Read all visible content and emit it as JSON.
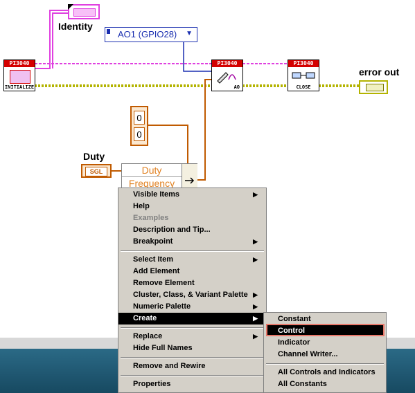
{
  "diagram": {
    "identity_label": "Identity",
    "error_out_label": "error out",
    "duty_label": "Duty",
    "ring_value": "AO1 (GPIO28)",
    "sgl_label": "SGL",
    "bundle_items": [
      "Duty",
      "Frequency"
    ],
    "numeric_values": [
      "0",
      "0"
    ],
    "vis": {
      "initialize": {
        "header": "PI3040",
        "caption": "INITIALIZE"
      },
      "write_ao": {
        "header": "PI3040",
        "caption": "AO"
      },
      "close": {
        "header": "PI3040",
        "caption": "CLOSE"
      }
    },
    "colors": {
      "error_wire": "#b3b300",
      "refnum_wire": "#e040e0",
      "ring_wire": "#1a2fb0",
      "cluster_wire": "#c05a00"
    }
  },
  "context_menu": {
    "items": [
      {
        "label": "Visible Items",
        "submenu": true
      },
      {
        "label": "Help"
      },
      {
        "label": "Examples",
        "disabled": true
      },
      {
        "label": "Description and Tip..."
      },
      {
        "label": "Breakpoint",
        "submenu": true
      },
      {
        "label": "Select Item",
        "submenu": true
      },
      {
        "label": "Add Element"
      },
      {
        "label": "Remove Element"
      },
      {
        "label": "Cluster, Class, & Variant Palette",
        "submenu": true
      },
      {
        "label": "Numeric Palette",
        "submenu": true
      },
      {
        "label": "Create",
        "submenu": true,
        "selected": true
      },
      {
        "label": "Replace",
        "submenu": true
      },
      {
        "label": "Hide Full Names"
      },
      {
        "label": "Remove and Rewire"
      },
      {
        "label": "Properties"
      }
    ],
    "create_submenu": [
      "Constant",
      "Control",
      "Indicator",
      "Channel Writer...",
      "All Controls and Indicators",
      "All Constants"
    ]
  }
}
